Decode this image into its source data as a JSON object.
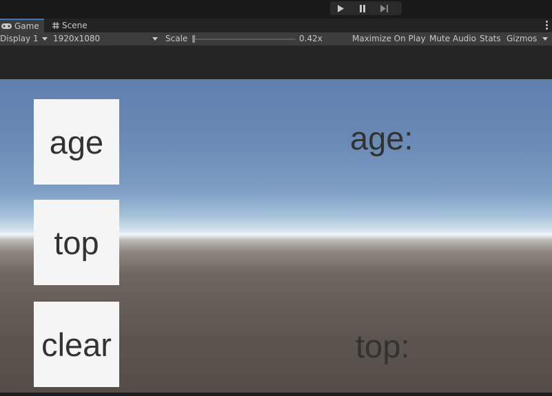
{
  "play_controls": {
    "play": "play-icon",
    "pause": "pause-icon",
    "step": "step-icon"
  },
  "tabs": [
    {
      "label": "Game",
      "icon": "gamepad-icon"
    },
    {
      "label": "Scene",
      "icon": "grid-icon"
    }
  ],
  "toolbar": {
    "display": "Display 1",
    "resolution": "1920x1080",
    "scale_label": "Scale",
    "scale_value": "0.42x",
    "maximize": "Maximize On Play",
    "mute": "Mute Audio",
    "stats": "Stats",
    "gizmos": "Gizmos"
  },
  "game": {
    "buttons": [
      "age",
      "top",
      "clear"
    ],
    "labels": {
      "age": "age:",
      "top": "top:"
    }
  },
  "colors": {
    "accent": "#3a79bb",
    "ui_button_bg": "#f5f5f5",
    "ui_text": "#323232"
  }
}
